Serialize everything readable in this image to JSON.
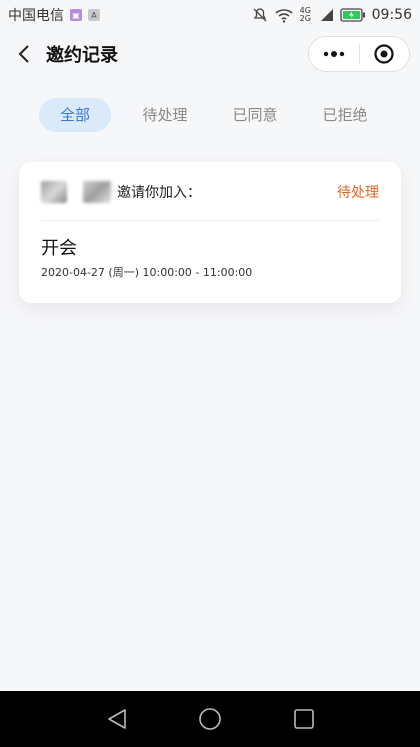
{
  "status_bar": {
    "carrier": "中国电信",
    "network": "4G 2G",
    "time": "09:56"
  },
  "header": {
    "title": "邀约记录"
  },
  "tabs": [
    {
      "label": "全部",
      "active": true
    },
    {
      "label": "待处理",
      "active": false
    },
    {
      "label": "已同意",
      "active": false
    },
    {
      "label": "已拒绝",
      "active": false
    }
  ],
  "invitations": [
    {
      "invite_text": "邀请你加入：",
      "status": "待处理",
      "event_name": "开会",
      "event_time": "2020-04-27 (周一) 10:00:00 - 11:00:00"
    }
  ],
  "colors": {
    "accent": "#3a78d6",
    "tab_active_bg": "#dbeafb",
    "pending": "#e8641f",
    "background": "#f6f7f9"
  },
  "icons": {
    "back": "back-chevron-icon",
    "more": "more-dots-icon",
    "close": "target-close-icon",
    "nav_back": "triangle-back-icon",
    "nav_home": "circle-home-icon",
    "nav_recent": "square-recent-icon"
  }
}
